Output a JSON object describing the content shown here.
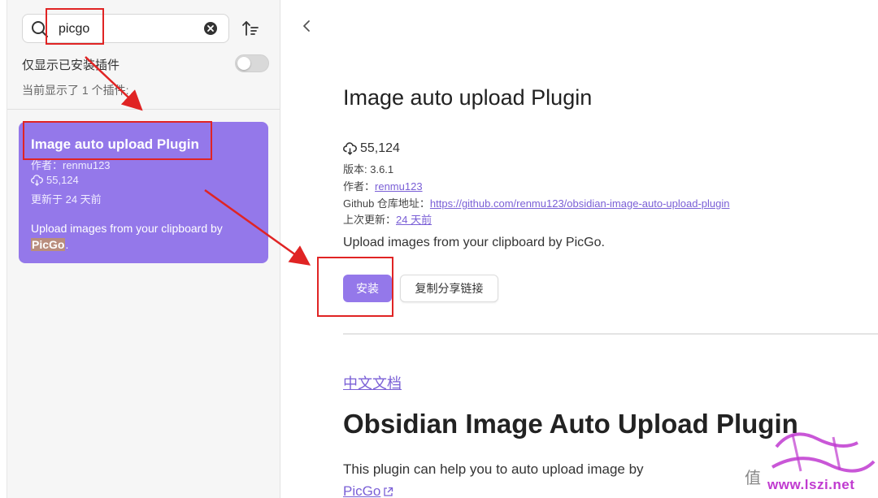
{
  "sidebar": {
    "search": {
      "value": "picgo",
      "placeholder": ""
    },
    "toggle_label": "仅显示已安装插件",
    "toggle_on": false,
    "count_label": "当前显示了 1 个插件:",
    "result_card": {
      "title": "Image auto upload Plugin",
      "author": "作者：renmu123",
      "downloads": "55,124",
      "updated": "更新于 24 天前",
      "desc_prefix": "Upload images from your clipboard by ",
      "desc_highlight": "PicGo",
      "desc_suffix": "."
    }
  },
  "detail": {
    "title": "Image auto upload Plugin",
    "downloads": "55,124",
    "version": "版本: 3.6.1",
    "author_label": "作者：",
    "author": "renmu123",
    "github_label": "Github 仓库地址：",
    "github_url": "https://github.com/renmu123/obsidian-image-auto-upload-plugin",
    "updated_label": "上次更新：",
    "updated": "24 天前",
    "description": "Upload images from your clipboard by PicGo.",
    "install_button": "安装",
    "copy_link_button": "复制分享链接",
    "readme": {
      "lang_link": "中文文档",
      "heading": "Obsidian Image Auto Upload Plugin",
      "paragraph": "This plugin can help you to auto upload image by",
      "picgo_link": "PicGo"
    }
  },
  "watermark": {
    "site": "www.lszi.net",
    "glyph": "值"
  },
  "colors": {
    "accent": "#9478ea",
    "link": "#7a5fd6",
    "annotation": "#e02424"
  }
}
